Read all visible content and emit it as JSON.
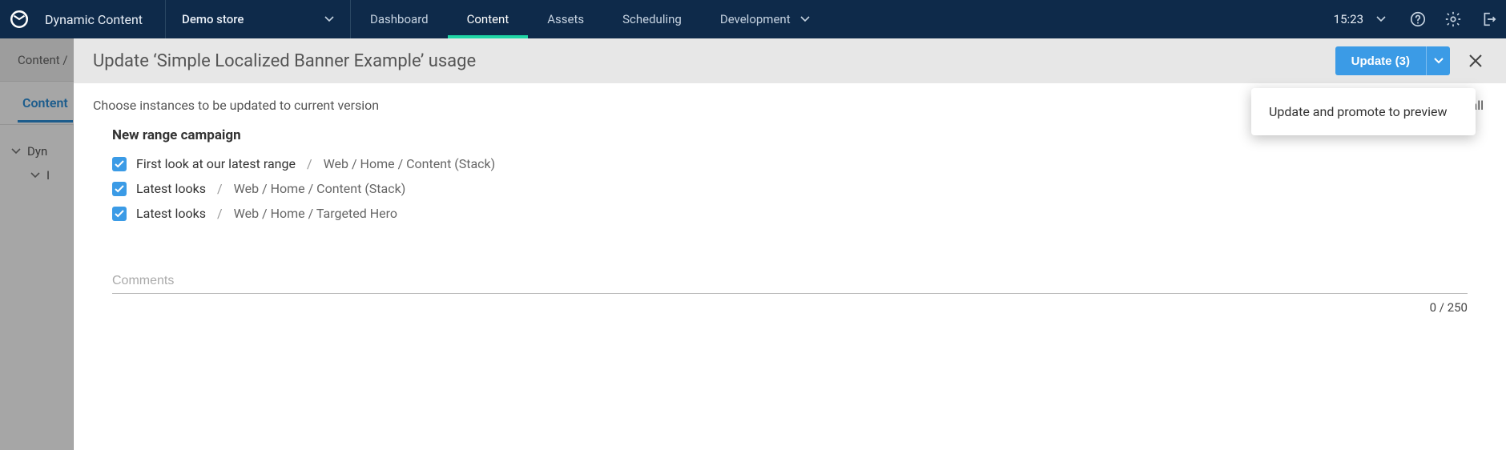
{
  "topbar": {
    "brand": "Dynamic Content",
    "hub": "Demo store",
    "nav": [
      "Dashboard",
      "Content",
      "Assets",
      "Scheduling",
      "Development"
    ],
    "active_nav_index": 1,
    "time": "15:23"
  },
  "secnav": {
    "breadcrumb": "Content  /"
  },
  "tabs": {
    "items": [
      "Content"
    ],
    "active_index": 0
  },
  "tree": {
    "items": [
      {
        "label": "Dyn",
        "indent": false
      },
      {
        "label": "I",
        "indent": true
      }
    ]
  },
  "panel": {
    "title": "Update ‘Simple Localized Banner Example’ usage",
    "update_button": "Update (3)",
    "close_label": "Close",
    "lead": "Choose instances to be updated to current version",
    "campaign": "New range campaign",
    "instances": [
      {
        "checked": true,
        "name": "First look at our latest range",
        "path": "Web / Home / Content (Stack)"
      },
      {
        "checked": true,
        "name": "Latest looks",
        "path": "Web / Home / Content (Stack)"
      },
      {
        "checked": true,
        "name": "Latest looks",
        "path": "Web / Home / Targeted Hero"
      }
    ],
    "comments_placeholder": "Comments",
    "charcount": "0 / 250",
    "deselect_all": "ct all"
  },
  "menu": {
    "items": [
      "Update and promote to preview"
    ]
  }
}
